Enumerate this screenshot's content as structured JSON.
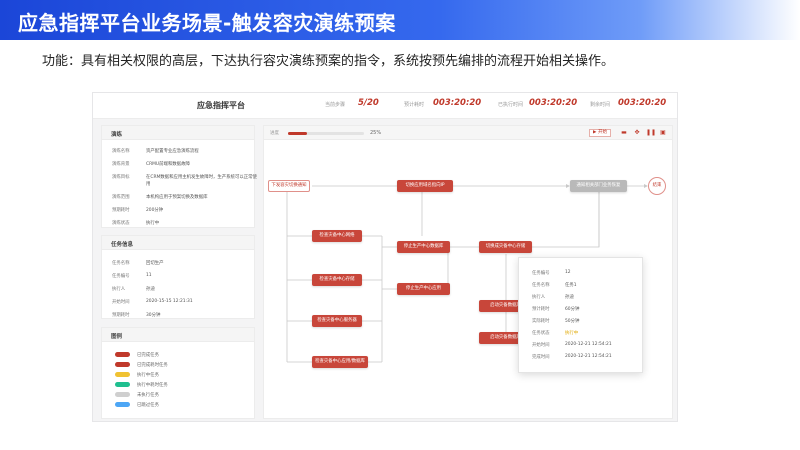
{
  "slide": {
    "banner_title": "应急指挥平台业务场景-触发容灾演练预案",
    "description": "功能：具有相关权限的高层，下达执行容灾演练预案的指令，系统按预先编排的流程开始相关操作。"
  },
  "app": {
    "title": "应急指挥平台",
    "stats": [
      {
        "label": "当前步骤",
        "value": "5/20"
      },
      {
        "label": "预计耗时",
        "value": "003:20:20"
      },
      {
        "label": "已执行时间",
        "value": "003:20:20"
      },
      {
        "label": "剩余时间",
        "value": "003:20:20"
      }
    ]
  },
  "drill_panel": {
    "title": "演练",
    "rows": [
      {
        "label": "演练名称",
        "value": "资产配置专业应急演练流程"
      },
      {
        "label": "演练背景",
        "value": "CRMU前端和数据故障"
      },
      {
        "label": "演练目标",
        "value": "在CRM数据和应用主机发生故障时，生产系统可以正常使用"
      },
      {
        "label": "演练范围",
        "value": "本机构应用于预案切换及数据库"
      },
      {
        "label": "预期耗时",
        "value": "200分钟"
      },
      {
        "label": "演练状态",
        "value": "执行中"
      }
    ]
  },
  "task_panel": {
    "title": "任务信息",
    "rows": [
      {
        "label": "任务名称",
        "value": "回切生产"
      },
      {
        "label": "任务编号",
        "value": "11"
      },
      {
        "label": "执行人",
        "value": "孙迪"
      },
      {
        "label": "开始时间",
        "value": "2020-15-15  12:21:31"
      },
      {
        "label": "预期耗时",
        "value": "30分钟"
      }
    ]
  },
  "legend_panel": {
    "title": "图例",
    "items": [
      {
        "label": "已完成任务",
        "color": "#c0392b"
      },
      {
        "label": "已完成耗时任务",
        "color": "#c0392b"
      },
      {
        "label": "执行中任务",
        "color": "#f0c232"
      },
      {
        "label": "执行中耗时任务",
        "color": "#1fbf8f"
      },
      {
        "label": "未执行任务",
        "color": "#cfcfcf"
      },
      {
        "label": "已跳过任务",
        "color": "#4da6f5"
      }
    ]
  },
  "toolbar": {
    "progress_label": "进度",
    "progress_fraction": 0.25,
    "progress_text": "25%",
    "start_label": "▶ 开始"
  },
  "flow": {
    "nodes": {
      "n_start": "下发容灾切换通知",
      "n_net": "检查灾备中心网络",
      "n_storage": "检查灾备中心存储",
      "n_host": "检查灾备中心服务器",
      "n_app": "检查灾备中心应用/数据库",
      "n_switch_dns": "切换应用域名指向IP",
      "n_stop_db": "停止生产中心数据库",
      "n_stop_app": "停止生产中心应用",
      "n_switch_storage": "切换成灾备中心存储",
      "n_start_db": "启动灾备数据库",
      "n_start_app": "启动灾备数据库",
      "n_notify": "通知相关部门业务恢复",
      "n_end": "结束"
    }
  },
  "popup": {
    "rows": [
      {
        "label": "任务编号",
        "value": "12"
      },
      {
        "label": "任务名称",
        "value": "任务1"
      },
      {
        "label": "执行人",
        "value": "孙迪"
      },
      {
        "label": "预计耗时",
        "value": "60分钟"
      },
      {
        "label": "实际耗时",
        "value": "50分钟"
      },
      {
        "label": "任务状态",
        "value": "执行中"
      },
      {
        "label": "开始时间",
        "value": "2020-12-21  12:54:21"
      },
      {
        "label": "完成时间",
        "value": "2020-12-21  12:54:21"
      }
    ]
  }
}
